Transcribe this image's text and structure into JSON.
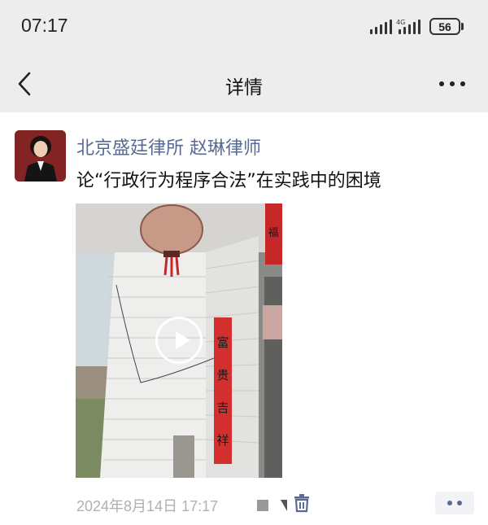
{
  "status": {
    "time": "07:17",
    "network_label": "4G",
    "battery": "56"
  },
  "nav": {
    "title": "详情"
  },
  "post": {
    "author": "北京盛廷律所 赵琳律师",
    "title": "论“行政行为程序合法”在实践中的困境",
    "timestamp": "2024年8月14日 17:17",
    "couplet_text": "富贵吉祥",
    "banner_top": "福"
  },
  "colors": {
    "link_blue": "#576b95",
    "bar_bg": "#ededed",
    "muted_text": "#b0b0b0"
  }
}
